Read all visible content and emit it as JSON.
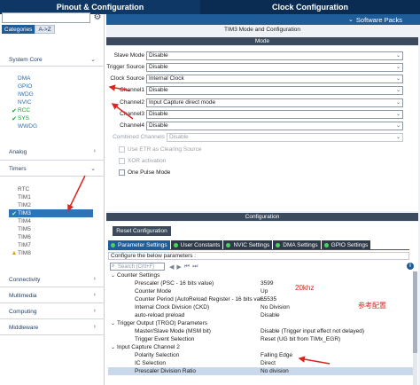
{
  "tabs": {
    "pinout": "Pinout & Configuration",
    "clock": "Clock Configuration"
  },
  "subheader": {
    "software_packs": "Software Packs"
  },
  "left": {
    "categories_tab": "Categories",
    "az_tab": "A->Z",
    "system_core": "System Core",
    "system_items": [
      {
        "label": "DMA",
        "state": "normal"
      },
      {
        "label": "GPIO",
        "state": "normal"
      },
      {
        "label": "IWDG",
        "state": "normal"
      },
      {
        "label": "NVIC",
        "state": "normal"
      },
      {
        "label": "RCC",
        "state": "ok"
      },
      {
        "label": "SYS",
        "state": "ok"
      },
      {
        "label": "WWDG",
        "state": "normal"
      }
    ],
    "analog": "Analog",
    "timers": "Timers",
    "timer_items": [
      {
        "label": "RTC",
        "state": "normal"
      },
      {
        "label": "TIM1",
        "state": "normal"
      },
      {
        "label": "TIM2",
        "state": "normal"
      },
      {
        "label": "TIM3",
        "state": "selected"
      },
      {
        "label": "TIM4",
        "state": "normal"
      },
      {
        "label": "TIM5",
        "state": "normal"
      },
      {
        "label": "TIM6",
        "state": "normal"
      },
      {
        "label": "TIM7",
        "state": "normal"
      },
      {
        "label": "TIM8",
        "state": "warn"
      }
    ],
    "connectivity": "Connectivity",
    "multimedia": "Multimedia",
    "computing": "Computing",
    "middleware": "Middleware"
  },
  "mode": {
    "title": "TIM3 Mode and Configuration",
    "section": "Mode",
    "fields": [
      {
        "label": "Slave Mode",
        "value": "Disable"
      },
      {
        "label": "Trigger Source",
        "value": "Disable"
      },
      {
        "label": "Clock Source",
        "value": "Internal Clock"
      },
      {
        "label": "Channel1",
        "value": "Disable"
      },
      {
        "label": "Channel2",
        "value": "Input Capture direct mode"
      },
      {
        "label": "Channel3",
        "value": "Disable"
      },
      {
        "label": "Channel4",
        "value": "Disable"
      }
    ],
    "combined_label": "Combined Channels",
    "combined_value": "Disable",
    "use_etr": "Use ETR as Clearing Source",
    "xor": "XOR activation",
    "one_pulse": "One Pulse Mode"
  },
  "config": {
    "section": "Configuration",
    "reset_button": "Reset Configuration",
    "tabs": [
      "Parameter Settings",
      "User Constants",
      "NVIC Settings",
      "DMA Settings",
      "GPIO Settings"
    ],
    "caption": "Configure the below parameters :",
    "search_placeholder": "Search (Crtl+F)",
    "params": [
      {
        "kind": "group",
        "name": "Counter Settings"
      },
      {
        "kind": "item",
        "name": "Prescaler (PSC - 16 bits value)",
        "value": "3599"
      },
      {
        "kind": "item",
        "name": "Counter Mode",
        "value": "Up"
      },
      {
        "kind": "item",
        "name": "Counter Period (AutoReload Register - 16 bits val...",
        "value": "65535"
      },
      {
        "kind": "item",
        "name": "Internal Clock Division (CKD)",
        "value": "No Division"
      },
      {
        "kind": "item",
        "name": "auto-reload preload",
        "value": "Disable"
      },
      {
        "kind": "group",
        "name": "Trigger Output (TRGO) Parameters"
      },
      {
        "kind": "item",
        "name": "Master/Slave Mode (MSM bit)",
        "value": "Disable (Trigger input effect not delayed)"
      },
      {
        "kind": "item",
        "name": "Trigger Event Selection",
        "value": "Reset (UG bit from TIMx_EGR)"
      },
      {
        "kind": "group",
        "name": "Input Capture Channel 2"
      },
      {
        "kind": "item",
        "name": "Polarity Selection",
        "value": "Falling Edge"
      },
      {
        "kind": "item",
        "name": "IC Selection",
        "value": "Direct"
      },
      {
        "kind": "item",
        "name": "Prescaler Division Ratio",
        "value": "No division"
      }
    ]
  },
  "notes": {
    "freq": "20khz",
    "ref": "参考配置"
  },
  "colors": {
    "header_dark": "#0f3766",
    "accent_blue": "#1f5d99",
    "status_green": "#1e9a2e",
    "warning": "#e2a000",
    "annotation_red": "#d9261f"
  }
}
